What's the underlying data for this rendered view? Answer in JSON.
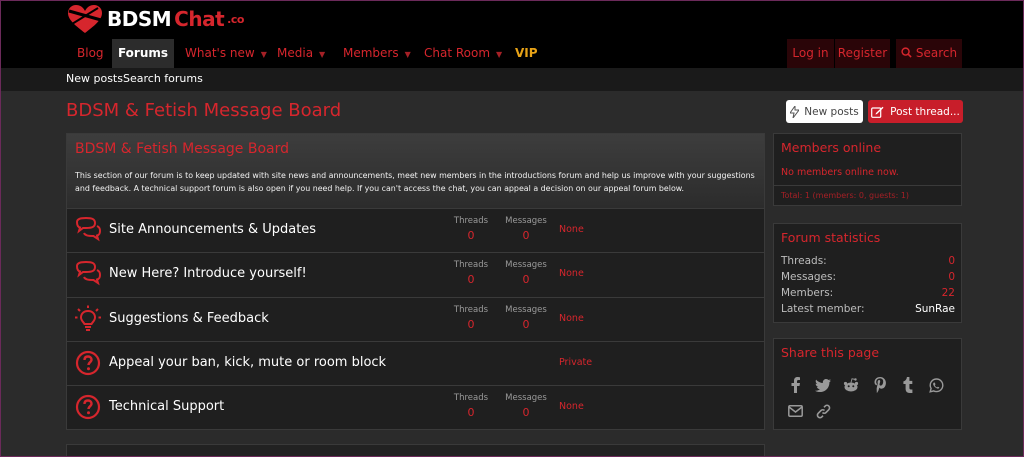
{
  "brand": {
    "w1": "BDSM",
    "w2": "Chat",
    "w3": ".co"
  },
  "nav": {
    "blog": "Blog",
    "forums": "Forums",
    "whats_new": "What's new",
    "media": "Media",
    "members": "Members",
    "chat_room": "Chat Room",
    "vip": "VIP",
    "login": "Log in",
    "register": "Register",
    "search": "Search"
  },
  "subnav": {
    "new_posts": "New posts",
    "search_forums": "Search forums"
  },
  "page": {
    "title": "BDSM & Fetish Message Board",
    "new_posts_btn": "New posts",
    "post_thread_btn": "Post thread..."
  },
  "board": {
    "title": "BDSM & Fetish Message Board",
    "description": "This section of our forum is to keep updated with site news and announcements, meet new members in the introductions forum and help us improve with your suggestions and feedback. A technical support forum is also open if you need help. If you can't access the chat, you can appeal a decision on our appeal forum below.",
    "threads_label": "Threads",
    "messages_label": "Messages",
    "rows": [
      {
        "title": "Site Announcements & Updates",
        "icon": "chat-bubbles-icon",
        "threads": "0",
        "messages": "0",
        "last": "None"
      },
      {
        "title": "New Here? Introduce yourself!",
        "icon": "chat-bubbles-icon",
        "threads": "0",
        "messages": "0",
        "last": "None"
      },
      {
        "title": "Suggestions & Feedback",
        "icon": "lightbulb-icon",
        "threads": "0",
        "messages": "0",
        "last": "None"
      },
      {
        "title": "Appeal your ban, kick, mute or room block",
        "icon": "question-icon",
        "last": "Private"
      },
      {
        "title": "Technical Support",
        "icon": "question-icon",
        "threads": "0",
        "messages": "0",
        "last": "None"
      }
    ]
  },
  "members_online": {
    "title": "Members online",
    "none": "No members online now.",
    "total": "Total: 1 (members: 0, guests: 1)"
  },
  "stats": {
    "title": "Forum statistics",
    "threads_label": "Threads:",
    "threads": "0",
    "messages_label": "Messages:",
    "messages": "0",
    "members_label": "Members:",
    "members": "22",
    "latest_label": "Latest member:",
    "latest": "SunRae"
  },
  "share": {
    "title": "Share this page",
    "icons": [
      "facebook-icon",
      "twitter-icon",
      "reddit-icon",
      "pinterest-icon",
      "tumblr-icon",
      "whatsapp-icon",
      "email-icon",
      "link-icon"
    ]
  },
  "colors": {
    "accent": "#d6262d",
    "background": "#2b2b2b",
    "panel": "#1f1f1f",
    "vip": "#e8a317"
  }
}
